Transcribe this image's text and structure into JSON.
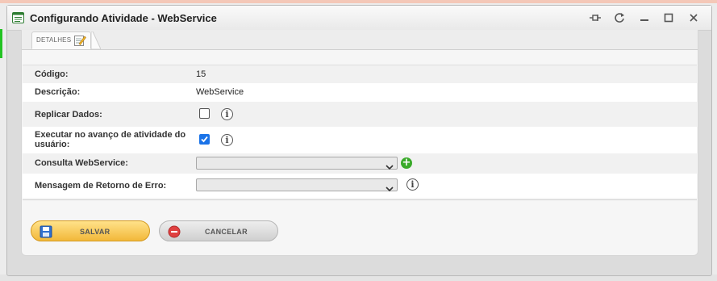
{
  "window": {
    "title": "Configurando Atividade - WebService"
  },
  "tabs": [
    {
      "label": "DETALHES"
    }
  ],
  "form": {
    "codigo": {
      "label": "Código:",
      "value": "15"
    },
    "descricao": {
      "label": "Descrição:",
      "value": "WebService"
    },
    "replicar": {
      "label": "Replicar Dados:",
      "checked": false
    },
    "executar": {
      "label_line1": "Executar no avanço de atividade do",
      "label_line2": "usuário:",
      "checked": true
    },
    "consulta": {
      "label": "Consulta WebService:",
      "value": ""
    },
    "mensagem": {
      "label": "Mensagem de Retorno de Erro:",
      "value": ""
    },
    "info_glyph": "i",
    "add_glyph": "+"
  },
  "buttons": {
    "save": "SALVAR",
    "cancel": "CANCELAR"
  },
  "colors": {
    "checkbox_checked": "#1a73e8",
    "add_button": "#3aaa2a",
    "save_button": "#f2b83a",
    "cancel_icon": "#e04040"
  }
}
